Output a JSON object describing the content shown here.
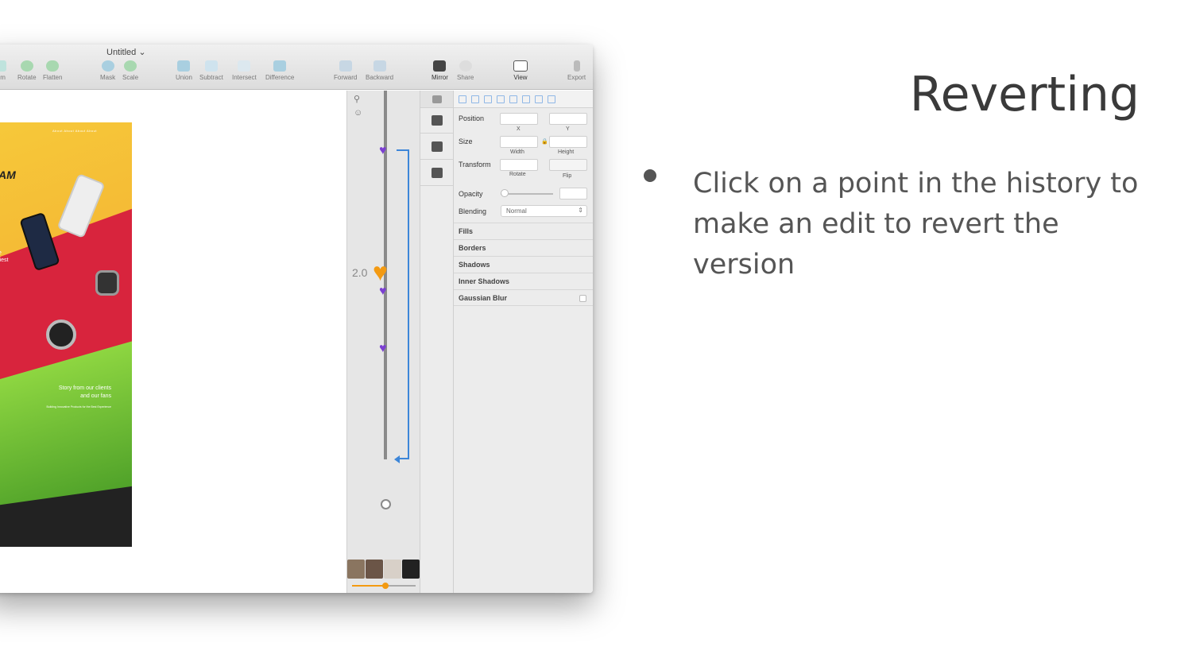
{
  "slide": {
    "title": "Reverting",
    "bullet": "Click on a point in the history to make an edit to revert the version"
  },
  "window": {
    "doc_title": "Untitled",
    "toolbar": [
      {
        "label": "orm",
        "icon": "transform-icon"
      },
      {
        "label": "Rotate",
        "icon": "rotate-icon"
      },
      {
        "label": "Flatten",
        "icon": "flatten-icon"
      },
      {
        "label": "Mask",
        "icon": "mask-icon"
      },
      {
        "label": "Scale",
        "icon": "scale-icon"
      },
      {
        "label": "Union",
        "icon": "union-icon"
      },
      {
        "label": "Subtract",
        "icon": "subtract-icon"
      },
      {
        "label": "Intersect",
        "icon": "intersect-icon"
      },
      {
        "label": "Difference",
        "icon": "difference-icon"
      },
      {
        "label": "Forward",
        "icon": "forward-icon"
      },
      {
        "label": "Backward",
        "icon": "backward-icon"
      },
      {
        "label": "Mirror",
        "icon": "mirror-icon"
      },
      {
        "label": "Share",
        "icon": "share-icon"
      },
      {
        "label": "View",
        "icon": "view-icon"
      },
      {
        "label": "Export",
        "icon": "export-icon"
      }
    ],
    "artboard": {
      "nav": "About   About   About   About",
      "headline": "AM",
      "side_text": "e\nliest",
      "story": "Story from our clients\nand our fans",
      "story_sub": "Building Innovative Products for the Best Experience"
    },
    "history": {
      "version_label": "2.0"
    },
    "inspector": {
      "position_label": "Position",
      "x_label": "X",
      "y_label": "Y",
      "size_label": "Size",
      "width_label": "Width",
      "height_label": "Height",
      "transform_label": "Transform",
      "rotate_label": "Rotate",
      "flip_label": "Flip",
      "opacity_label": "Opacity",
      "blending_label": "Blending",
      "blending_value": "Normal",
      "sections": [
        "Fills",
        "Borders",
        "Shadows",
        "Inner Shadows",
        "Gaussian Blur"
      ]
    }
  },
  "colors": {
    "history_heart": "#7b3fd1",
    "active_version": "#f39a12",
    "history_bracket": "#3d86d8"
  }
}
